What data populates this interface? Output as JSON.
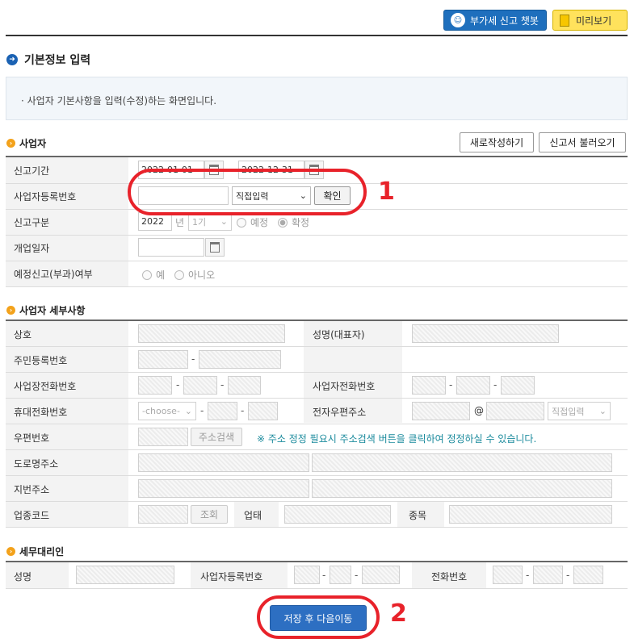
{
  "header": {
    "chatbot_label": "부가세 신고 챗봇",
    "preview_label": "미리보기"
  },
  "page": {
    "title": "기본정보 입력",
    "info_text": "· 사업자 기본사항을 입력(수정)하는 화면입니다."
  },
  "business": {
    "section_title": "사업자",
    "new_button": "새로작성하기",
    "load_button": "신고서 불러오기",
    "period_label": "신고기간",
    "period_start": "2022-01-01",
    "period_end": "2022-12-31",
    "regno_label": "사업자등록번호",
    "regno_value": "",
    "regno_select": "직접입력",
    "confirm_button": "확인",
    "report_type_label": "신고구분",
    "year": "2022",
    "year_suffix": "년",
    "term": "1기",
    "radio_planned": "예정",
    "radio_final": "확정",
    "open_date_label": "개업일자",
    "planned_tax_label": "예정신고(부과)여부",
    "radio_yes": "예",
    "radio_no": "아니오"
  },
  "details": {
    "section_title": "사업자 세부사항",
    "trade_name_label": "상호",
    "rep_name_label": "성명(대표자)",
    "rrn_label": "주민등록번호",
    "biz_phone_label": "사업장전화번호",
    "biz_phone2_label": "사업자전화번호",
    "mobile_label": "휴대전화번호",
    "mobile_select": "-choose-",
    "email_label": "전자우편주소",
    "email_at": "@",
    "email_select": "직접입력",
    "zip_label": "우편번호",
    "address_search_button": "주소검색",
    "address_note": "※ 주소 정정 필요시 주소검색 버튼을 클릭하여 정정하실 수 있습니다.",
    "road_address_label": "도로명주소",
    "lot_address_label": "지번주소",
    "industry_code_label": "업종코드",
    "lookup_button": "조회",
    "business_type_label": "업태",
    "item_label": "종목"
  },
  "agent": {
    "section_title": "세무대리인",
    "name_label": "성명",
    "regno_label": "사업자등록번호",
    "phone_label": "전화번호"
  },
  "footer": {
    "save_button": "저장 후 다음이동"
  },
  "annotations": {
    "marker_1": "1",
    "marker_2": "2"
  }
}
